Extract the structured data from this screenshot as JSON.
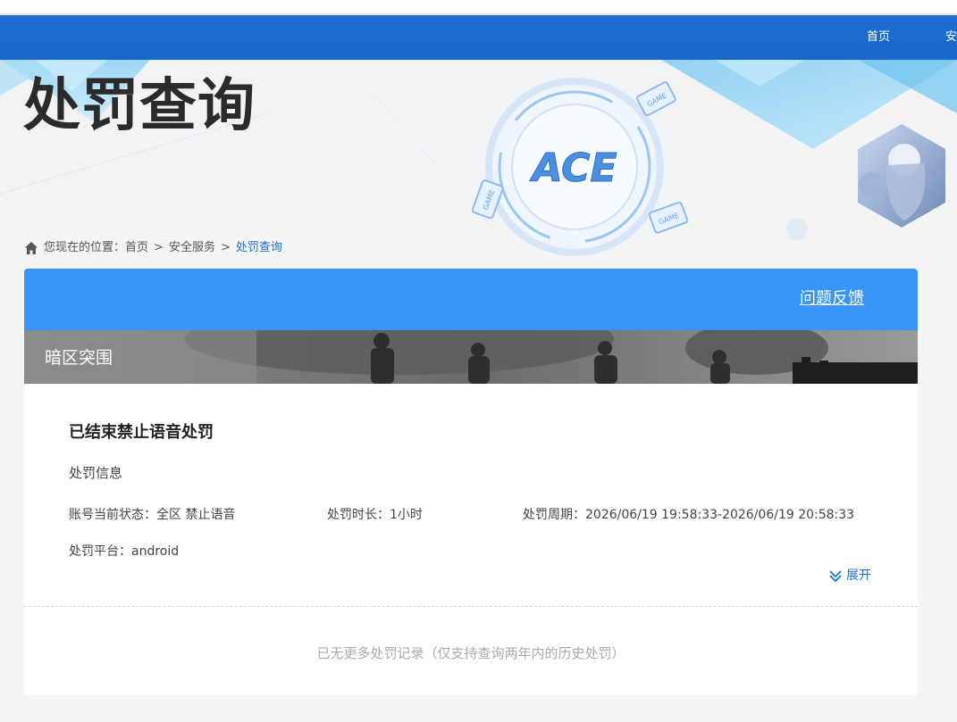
{
  "nav": {
    "home_label": "首页",
    "security_label": "安"
  },
  "page": {
    "title": "处罚查询"
  },
  "breadcrumb": {
    "prefix": "您现在的位置：",
    "items": [
      "首页",
      "安全服务",
      "处罚查询"
    ],
    "separator": ">"
  },
  "hero": {
    "logo_text": "ACE",
    "badge_text": "GAME"
  },
  "panel": {
    "feedback_label": "问题反馈"
  },
  "game": {
    "name": "暗区突围"
  },
  "record": {
    "title": "已结束禁止语音处罚",
    "info_heading": "处罚信息",
    "status_label": "账号当前状态：",
    "status_value": "全区 禁止语音",
    "duration_label": "处罚时长：",
    "duration_value": "1小时",
    "period_label": "处罚周期：",
    "period_value": "2026/06/19 19:58:33-2026/06/19 20:58:33",
    "platform_label": "处罚平台：",
    "platform_value": "android",
    "expand_label": "展开"
  },
  "footer_note": "已无更多处罚记录（仅支持查询两年内的历史处罚）",
  "colors": {
    "nav_bg": "#1767c8",
    "panel_bg": "#3795f8",
    "accent": "#1d6fd1",
    "title_text": "#2b2b2b"
  }
}
